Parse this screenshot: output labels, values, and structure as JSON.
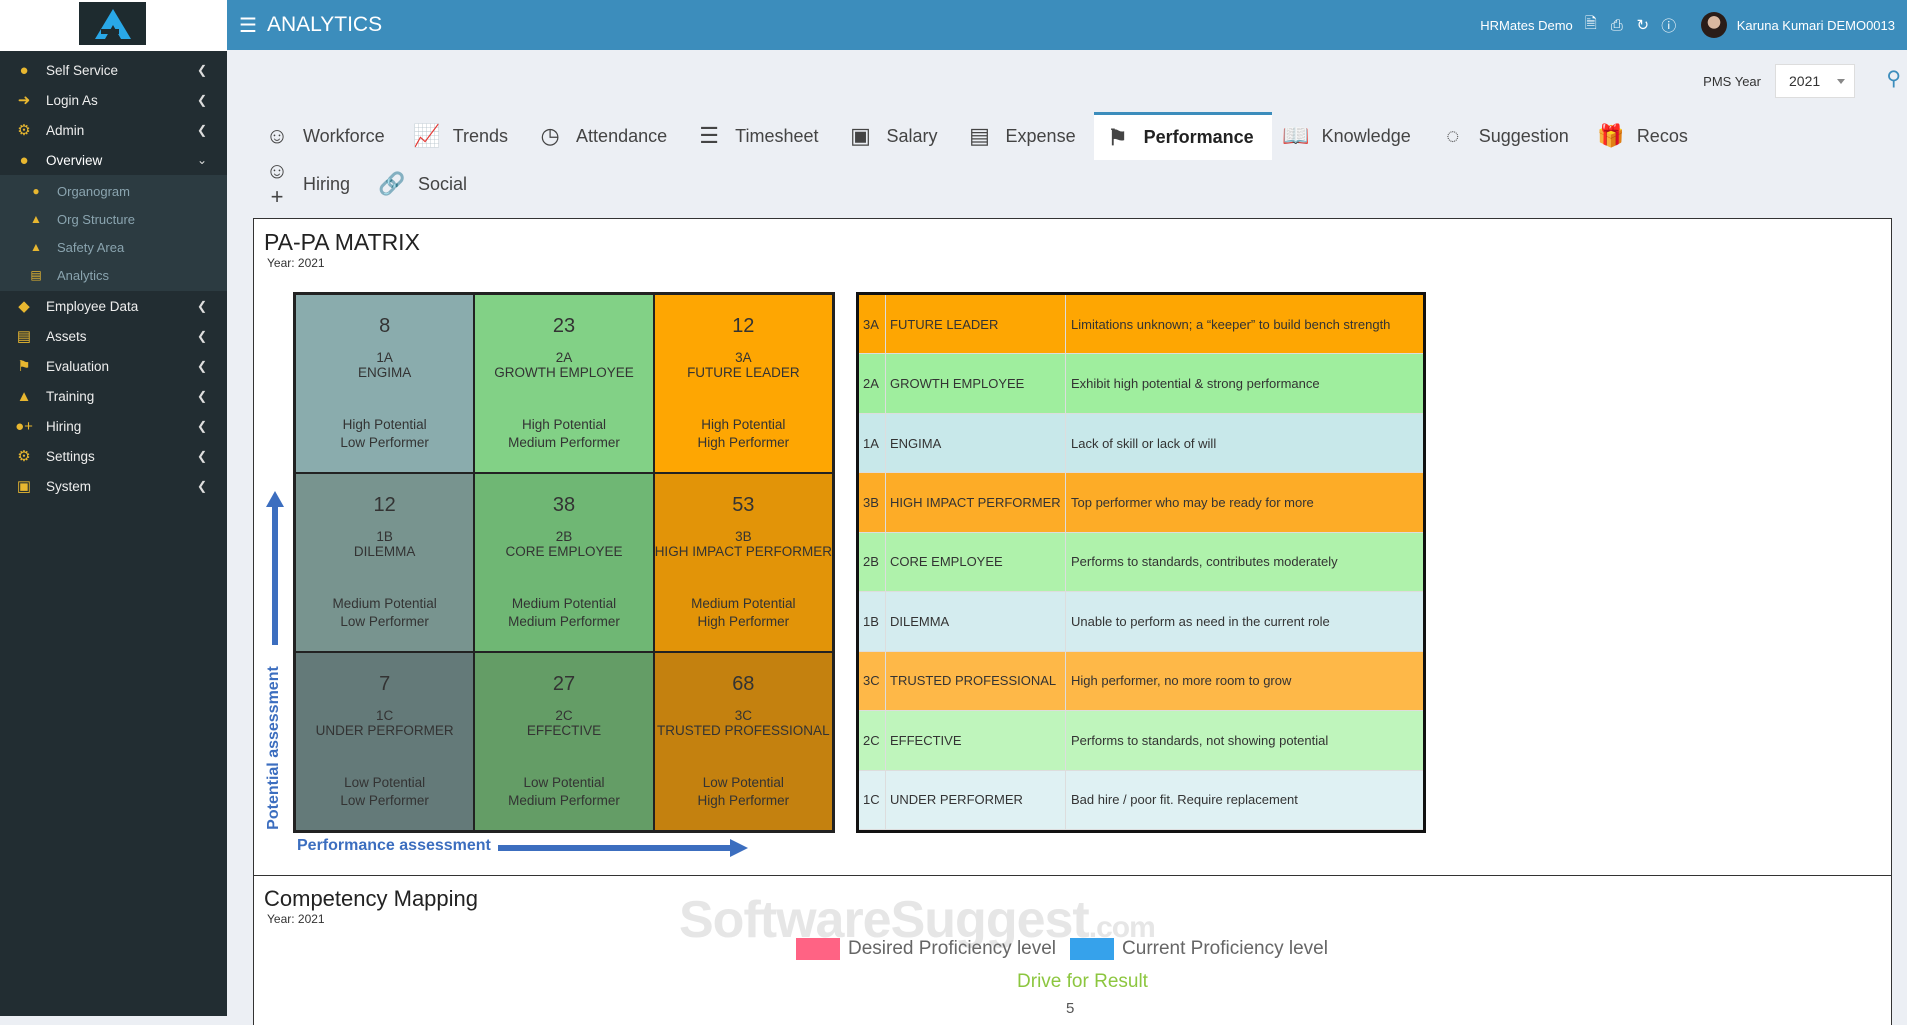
{
  "sidebar": {
    "items": [
      {
        "label": "Self Service",
        "icon": "user-icon"
      },
      {
        "label": "Login As",
        "icon": "sign-in-icon"
      },
      {
        "label": "Admin",
        "icon": "gear-icon"
      },
      {
        "label": "Overview",
        "icon": "user-tie-icon"
      },
      {
        "label": "Employee Data",
        "icon": "tag-icon"
      },
      {
        "label": "Assets",
        "icon": "assets-icon"
      },
      {
        "label": "Evaluation",
        "icon": "flag-checkered-icon"
      },
      {
        "label": "Training",
        "icon": "graduation-cap-icon"
      },
      {
        "label": "Hiring",
        "icon": "user-plus-icon"
      },
      {
        "label": "Settings",
        "icon": "gears-icon"
      },
      {
        "label": "System",
        "icon": "desktop-icon"
      }
    ],
    "submenu": [
      {
        "label": "Organogram"
      },
      {
        "label": "Org Structure"
      },
      {
        "label": "Safety Area"
      },
      {
        "label": "Analytics"
      }
    ]
  },
  "header": {
    "title": "ANALYTICS",
    "company": "HRMates Demo",
    "user": "Karuna Kumari DEMO0013"
  },
  "filter": {
    "label": "PMS Year",
    "value": "2021"
  },
  "tabs": [
    {
      "label": "Workforce"
    },
    {
      "label": "Trends"
    },
    {
      "label": "Attendance"
    },
    {
      "label": "Timesheet"
    },
    {
      "label": "Salary"
    },
    {
      "label": "Expense"
    },
    {
      "label": "Performance"
    },
    {
      "label": "Knowledge"
    },
    {
      "label": "Suggestion"
    },
    {
      "label": "Recos"
    },
    {
      "label": "Hiring"
    },
    {
      "label": "Social"
    }
  ],
  "matrix": {
    "title": "PA-PA MATRIX",
    "year": "Year: 2021",
    "y_label": "Potential assessment",
    "x_label": "Performance assessment",
    "cells": [
      {
        "count": "8",
        "code": "1A",
        "name": "ENGIMA",
        "potential": "High Potential",
        "performer": "Low Performer",
        "color": "#8aacad"
      },
      {
        "count": "23",
        "code": "2A",
        "name": "GROWTH EMPLOYEE",
        "potential": "High Potential",
        "performer": "Medium Performer",
        "color": "#82d186"
      },
      {
        "count": "12",
        "code": "3A",
        "name": "FUTURE LEADER",
        "potential": "High Potential",
        "performer": "High Performer",
        "color": "#fea602"
      },
      {
        "count": "12",
        "code": "1B",
        "name": "DILEMMA",
        "potential": "Medium Potential",
        "performer": "Low Performer",
        "color": "#78948f"
      },
      {
        "count": "38",
        "code": "2B",
        "name": "CORE EMPLOYEE",
        "potential": "Medium Potential",
        "performer": "Medium Performer",
        "color": "#6fb774"
      },
      {
        "count": "53",
        "code": "3B",
        "name": "HIGH IMPACT PERFORMER",
        "potential": "Medium Potential",
        "performer": "High Performer",
        "color": "#e29408"
      },
      {
        "count": "7",
        "code": "1C",
        "name": "UNDER PERFORMER",
        "potential": "Low Potential",
        "performer": "Low Performer",
        "color": "#647a79"
      },
      {
        "count": "27",
        "code": "2C",
        "name": "EFFECTIVE",
        "potential": "Low Potential",
        "performer": "Medium Performer",
        "color": "#649d66"
      },
      {
        "count": "68",
        "code": "3C",
        "name": "TRUSTED PROFESSIONAL",
        "potential": "Low Potential",
        "performer": "High Performer",
        "color": "#c4810f"
      }
    ]
  },
  "legend_table": [
    {
      "code": "3A",
      "name": "FUTURE LEADER",
      "desc": "Limitations unknown; a “keeper” to build bench strength",
      "color": "#fea602"
    },
    {
      "code": "2A",
      "name": "GROWTH EMPLOYEE",
      "desc": "Exhibit high potential & strong performance",
      "color": "#9fee9e"
    },
    {
      "code": "1A",
      "name": "ENGIMA",
      "desc": "Lack of skill or lack of will",
      "color": "#c8e8ea"
    },
    {
      "code": "3B",
      "name": "HIGH IMPACT PERFORMER",
      "desc": "Top performer who may be ready for more",
      "color": "#fdac27"
    },
    {
      "code": "2B",
      "name": "CORE EMPLOYEE",
      "desc": "Performs to standards, contributes moderately",
      "color": "#aff2ab"
    },
    {
      "code": "1B",
      "name": "DILEMMA",
      "desc": "Unable to perform as need in the current role",
      "color": "#d4ecef"
    },
    {
      "code": "3C",
      "name": "TRUSTED PROFESSIONAL",
      "desc": "High performer, no more room to grow",
      "color": "#feb848"
    },
    {
      "code": "2C",
      "name": "EFFECTIVE",
      "desc": "Performs to standards, not showing potential",
      "color": "#bff5bc"
    },
    {
      "code": "1C",
      "name": "UNDER PERFORMER",
      "desc": "Bad hire / poor fit. Require replacement",
      "color": "#dff1f3"
    }
  ],
  "competency": {
    "title": "Competency Mapping",
    "year": "Year: 2021",
    "legend_desired": "Desired Proficiency level",
    "legend_current": "Current Proficiency level",
    "desired_color": "#ff6384",
    "current_color": "#36a2eb",
    "chart_title": "Drive for Result",
    "tick": "5"
  },
  "watermark": {
    "text": "SoftwareSuggest",
    "suffix": ".com"
  }
}
